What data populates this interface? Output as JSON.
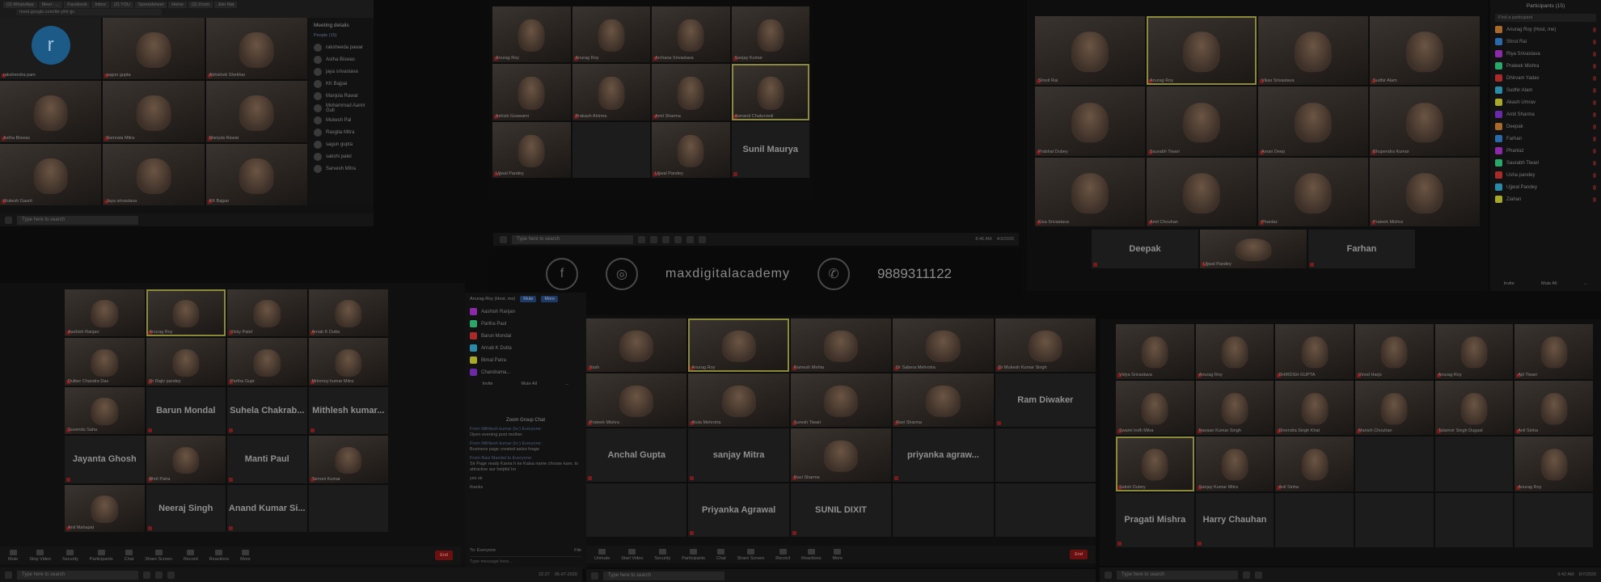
{
  "browser": {
    "tabs": [
      "(2) WhatsApp",
      "Meet - ...",
      "Facebook",
      "Inbox",
      "(2) YOU",
      "Spreadsheet",
      "Home",
      "(2) Zoom",
      "Join Nat"
    ],
    "url": "meet.google.com/ibr-yhtr-jjs"
  },
  "meet": {
    "sidebar_title": "Meeting details",
    "people_label": "People (15)",
    "people": [
      "raksheeda pawar",
      "Astha Biswas",
      "jaya srivastava",
      "KK Bajpai",
      "Manjula Rawat",
      "Mohammad Aamir Gull",
      "Mukesh Pal",
      "Rasgita Mitra",
      "sagun gupta",
      "sakshi patel",
      "Sarvesh Mitra"
    ],
    "tiles": [
      {
        "name": "rakshendra pam",
        "avatar": "r"
      },
      {
        "name": "sagun gupta"
      },
      {
        "name": "Abhishek Shekhar"
      },
      {
        "name": "Astha Biswas"
      },
      {
        "name": "Namrata Mitra"
      },
      {
        "name": "Manjula Rawat"
      },
      {
        "name": "Mukesh Gaurti"
      },
      {
        "name": "Jaya srivastava"
      },
      {
        "name": "KK Bajpai"
      }
    ]
  },
  "zoom_a": {
    "tiles": [
      "Anurag Roy",
      "Anurag Roy",
      "Archana Srivastava",
      "Sanjay Kumar",
      "Ashish Goswami",
      "Prakash Ahirma",
      "Amit Sharma",
      "Awnand Chaturvedi",
      "Ujjwal Pandey",
      "Sunil Maurya"
    ],
    "big_name": "Sunil Maurya",
    "taskbar_search": "Type here to search",
    "clock": "8:46 AM",
    "date": "4/3/2020"
  },
  "banner": {
    "brand": "maxdigitalacademy",
    "phone": "9889311122"
  },
  "zoom_b": {
    "tiles": [
      "Shruti Rai",
      "Anurag Roy",
      "Vikas Srivastava",
      "Sudhir Alam",
      "Prabhat Dubey",
      "Saurabh Tiwari",
      "Aman Deep",
      "Bhupendra Kumar",
      "Kisa Srivastava",
      "Amit Chouhan",
      "Phanlaz",
      "Prateek Mishra",
      "Ujjwal Pandey"
    ],
    "big_names": [
      "Deepak",
      "Farhan"
    ],
    "participants_title": "Participants (15)",
    "participants_search": "Find a participant",
    "participants": [
      "Anurag Roy (Host, me)",
      "Shrut Rai",
      "Riya Srivastava",
      "Prateek Mishra",
      "Dhirvam Yadav",
      "Sudhir Alam",
      "Akash Umrav",
      "Amit Sharma",
      "Deepak",
      "Farhan",
      "Phanlaz",
      "Saurabh Tiwari",
      "Usha pandey",
      "Ujjwal Pandey",
      "Ziahan"
    ],
    "footer": [
      "Invite",
      "Mute All",
      "..."
    ]
  },
  "zoom_c": {
    "tiles": [
      "Aashish Ranjan",
      "Anurag Roy",
      "Vicky Patel",
      "Arnab K Dutta",
      "Dulber Chandra Das",
      "Dr Rajiv pandey",
      "Partha Gupt",
      "Mrinmoy kumar Mitra",
      "Suvendu Saha"
    ],
    "big_names": [
      "Barun Mondal",
      "Suhela Chakrab...",
      "Mithlesh kumar...",
      "Jayanta Ghosh",
      "Manti Paul",
      "Neeraj Singh",
      "Anand Kumar Si..."
    ],
    "small_names": [
      "Bhrit Patra",
      "Tamoni Kumar",
      "Anil Mahapat"
    ],
    "toolbar": [
      "Mute",
      "Stop Video",
      "Security",
      "Participants",
      "Chat",
      "Share Screen",
      "Record",
      "Reactions",
      "More"
    ],
    "end": "End",
    "taskbar_search": "Type here to search"
  },
  "zoom_c_side": {
    "header": [
      "Anurag Roy (Host, me)",
      "Mute",
      "More"
    ],
    "participants": [
      "Aashish Ranjan",
      "Partha Paul",
      "Barun Mondal",
      "Arnab K Dutta",
      "Bimal Patra",
      "Chandrama..."
    ],
    "actions": [
      "Invite",
      "Mute All",
      "..."
    ],
    "chat_title": "Zoom Group Chat",
    "messages": [
      {
        "from": "From Mithlesh kumar (to:) Everyone:",
        "text": "Open evening post mother"
      },
      {
        "from": "From Mithlesh kumar (to:) Everyone:",
        "text": "Business page created aalso fnage"
      },
      {
        "from": "From Ravi Mandal to Everyone:",
        "text": "Sir Page ready Karna h ke Kaisa name choose kare, to attractive aur helpful ho"
      },
      {
        "from": "",
        "text": "yes sir"
      },
      {
        "from": "",
        "text": "thanks"
      }
    ],
    "to_label": "To: Everyone",
    "file_label": "File",
    "placeholder": "Type message here...",
    "clock": "22:27",
    "date": "05-07-2020"
  },
  "zoom_d": {
    "tiles": [
      "Yash",
      "Anurag Roy",
      "Ramesh Mehta",
      "Dr Sabera Mehrotra",
      "Dr Mukesh Kumar Singh",
      "Prateek Mishra",
      "Atula Mehrotra",
      "Suresh Tiwari",
      "Ravi Sharma",
      "Ravi Sharma"
    ],
    "big_names": [
      "Ram Diwaker",
      "Anchal Gupta",
      "sanjay Mitra",
      "priyanka agraw...",
      "Priyanka Agrawal",
      "SUNIL DIXIT"
    ],
    "toolbar": [
      "Unmute",
      "Start Video",
      "Security",
      "Participants",
      "Chat",
      "Share Screen",
      "Record",
      "Reactions",
      "More"
    ],
    "end": "End",
    "taskbar_search": "Type here to search"
  },
  "zoom_e": {
    "tiles": [
      "Vidya Srivastava",
      "Anurag Roy",
      "DHIRDSH GUPTA",
      "Vinod Harjo",
      "Anurag Roy",
      "Ajit Tiwari",
      "Swami Indh Mitra",
      "Navaan Kumar Singh",
      "Dinendra Singh Khat",
      "Manish Chouhan",
      "Talamvir Singh Dugast",
      "Anil Sinha",
      "Satish Dubey",
      "Sanjay Kumar Mitra",
      "Anil Sinha",
      "Anurag Roy"
    ],
    "big_names": [
      "Pragati Mishra",
      "Harry Chauhan"
    ],
    "taskbar_search": "Type here to search",
    "clock": "9:42 AM",
    "date": "6/7/2020"
  }
}
